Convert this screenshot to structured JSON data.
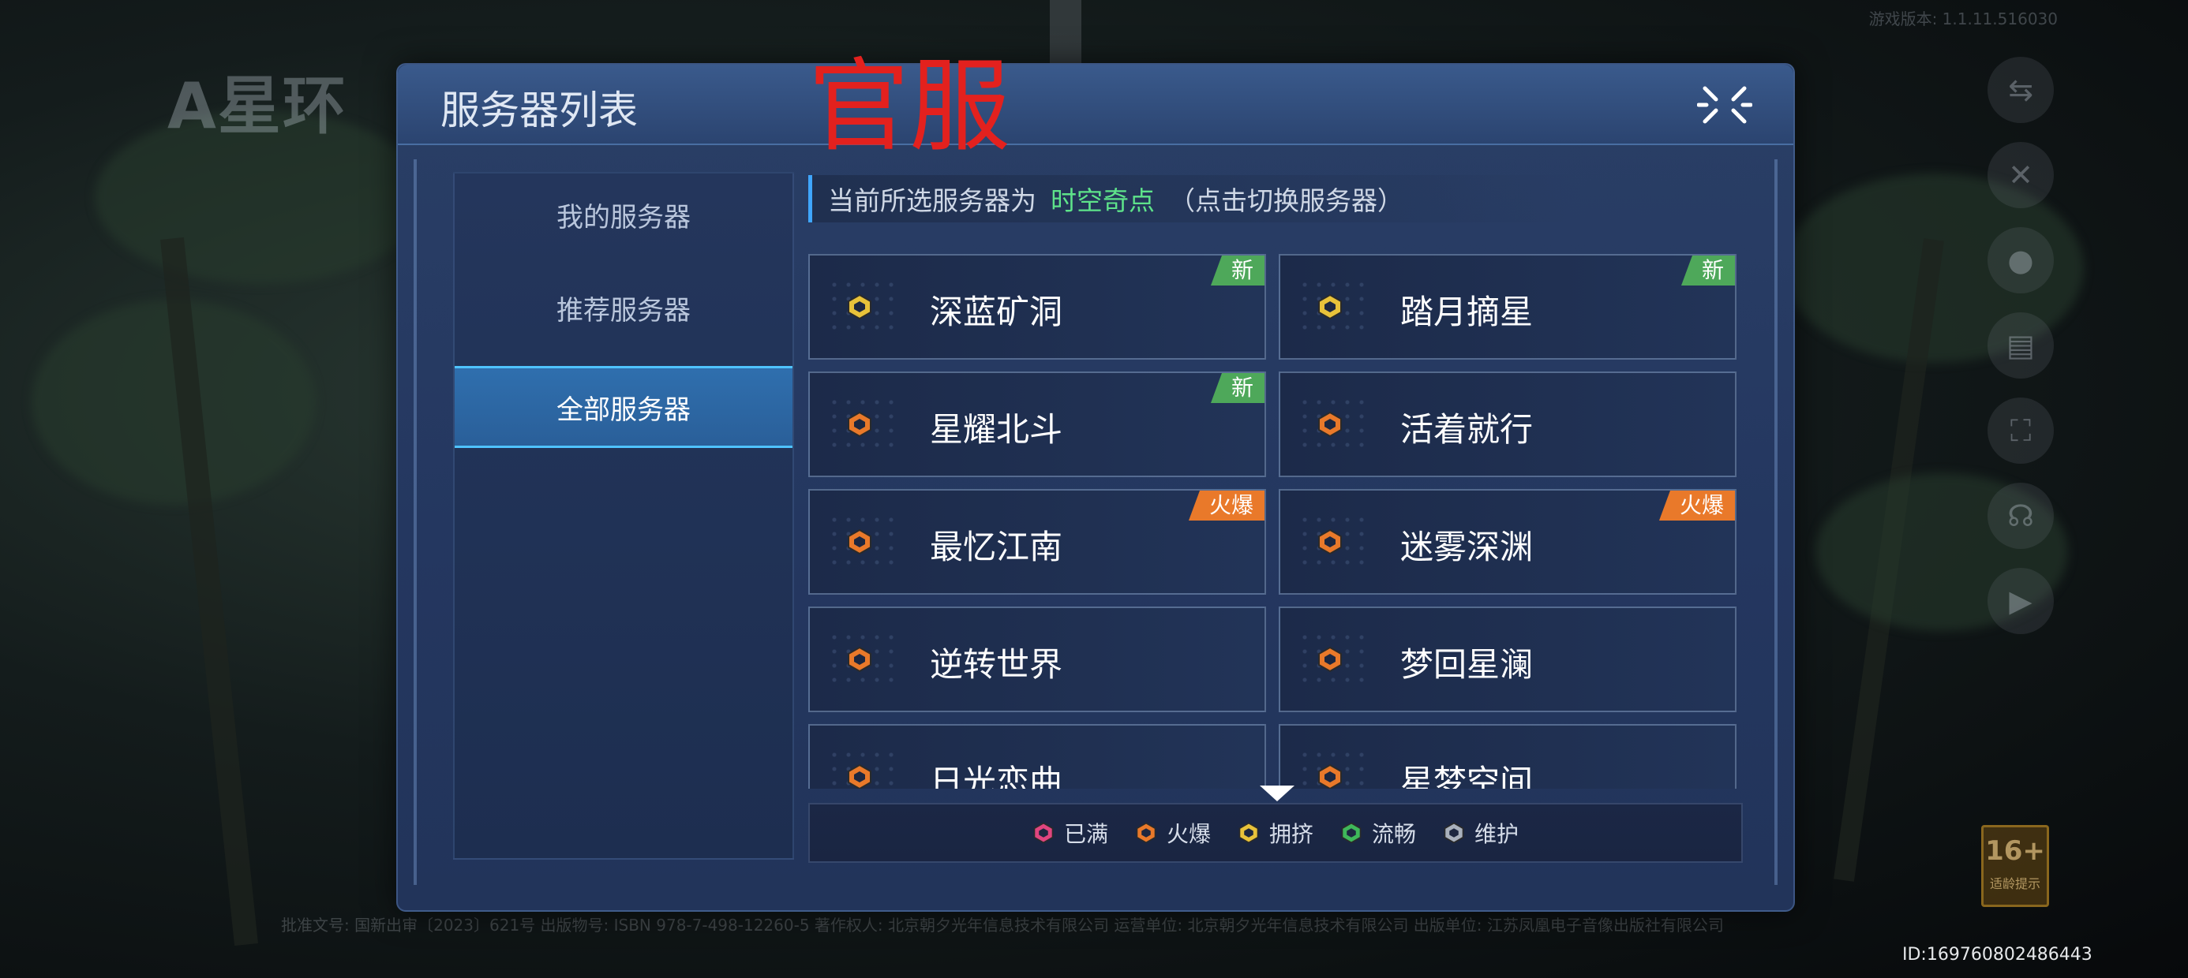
{
  "background": {
    "logo_text": "A星环",
    "version_text": "游戏版本: 1.1.11.516030",
    "footer_text": "批准文号: 国新出审〔2023〕621号 出版物号: ISBN 978-7-498-12260-5 著作权人: 北京朝夕光年信息技术有限公司 运营单位: 北京朝夕光年信息技术有限公司 出版单位: 江苏凤凰电子音像出版社有限公司",
    "uid": "ID:169760802486443",
    "age_rating": {
      "number": "16+",
      "label": "适龄提示"
    },
    "side_icons": [
      "translate-icon",
      "tools-icon",
      "user-icon",
      "notice-icon",
      "scan-icon",
      "support-icon",
      "video-icon"
    ]
  },
  "dialog": {
    "title": "服务器列表",
    "overlay_label": "官服",
    "close_icon": "close-icon",
    "nav": [
      {
        "label": "我的服务器",
        "selected": false
      },
      {
        "label": "推荐服务器",
        "selected": false
      },
      {
        "label": "全部服务器",
        "selected": true
      }
    ],
    "info": {
      "prefix": "当前所选服务器为",
      "current_server": "时空奇点",
      "hint": "（点击切换服务器）"
    },
    "servers": [
      {
        "name": "深蓝矿洞",
        "status": "crowded",
        "badge": "新",
        "badge_type": "new"
      },
      {
        "name": "踏月摘星",
        "status": "crowded",
        "badge": "新",
        "badge_type": "new"
      },
      {
        "name": "星耀北斗",
        "status": "hot",
        "badge": "新",
        "badge_type": "new"
      },
      {
        "name": "活着就行",
        "status": "hot",
        "badge": "",
        "badge_type": ""
      },
      {
        "name": "最忆江南",
        "status": "hot",
        "badge": "火爆",
        "badge_type": "hot"
      },
      {
        "name": "迷雾深渊",
        "status": "hot",
        "badge": "火爆",
        "badge_type": "hot"
      },
      {
        "name": "逆转世界",
        "status": "hot",
        "badge": "",
        "badge_type": ""
      },
      {
        "name": "梦回星澜",
        "status": "hot",
        "badge": "",
        "badge_type": ""
      },
      {
        "name": "日光恋曲",
        "status": "hot",
        "badge": "",
        "badge_type": ""
      },
      {
        "name": "星梦空间",
        "status": "hot",
        "badge": "",
        "badge_type": ""
      }
    ],
    "legend": [
      {
        "label": "已满",
        "color": "#e0457f"
      },
      {
        "label": "火爆",
        "color": "#e9792a"
      },
      {
        "label": "拥挤",
        "color": "#e8c23a"
      },
      {
        "label": "流畅",
        "color": "#3fb85a"
      },
      {
        "label": "维护",
        "color": "#a9b1bd"
      }
    ],
    "status_colors": {
      "full": "#e0457f",
      "hot": "#e9792a",
      "crowded": "#e8c23a",
      "smooth": "#3fb85a",
      "maintenance": "#a9b1bd"
    }
  }
}
